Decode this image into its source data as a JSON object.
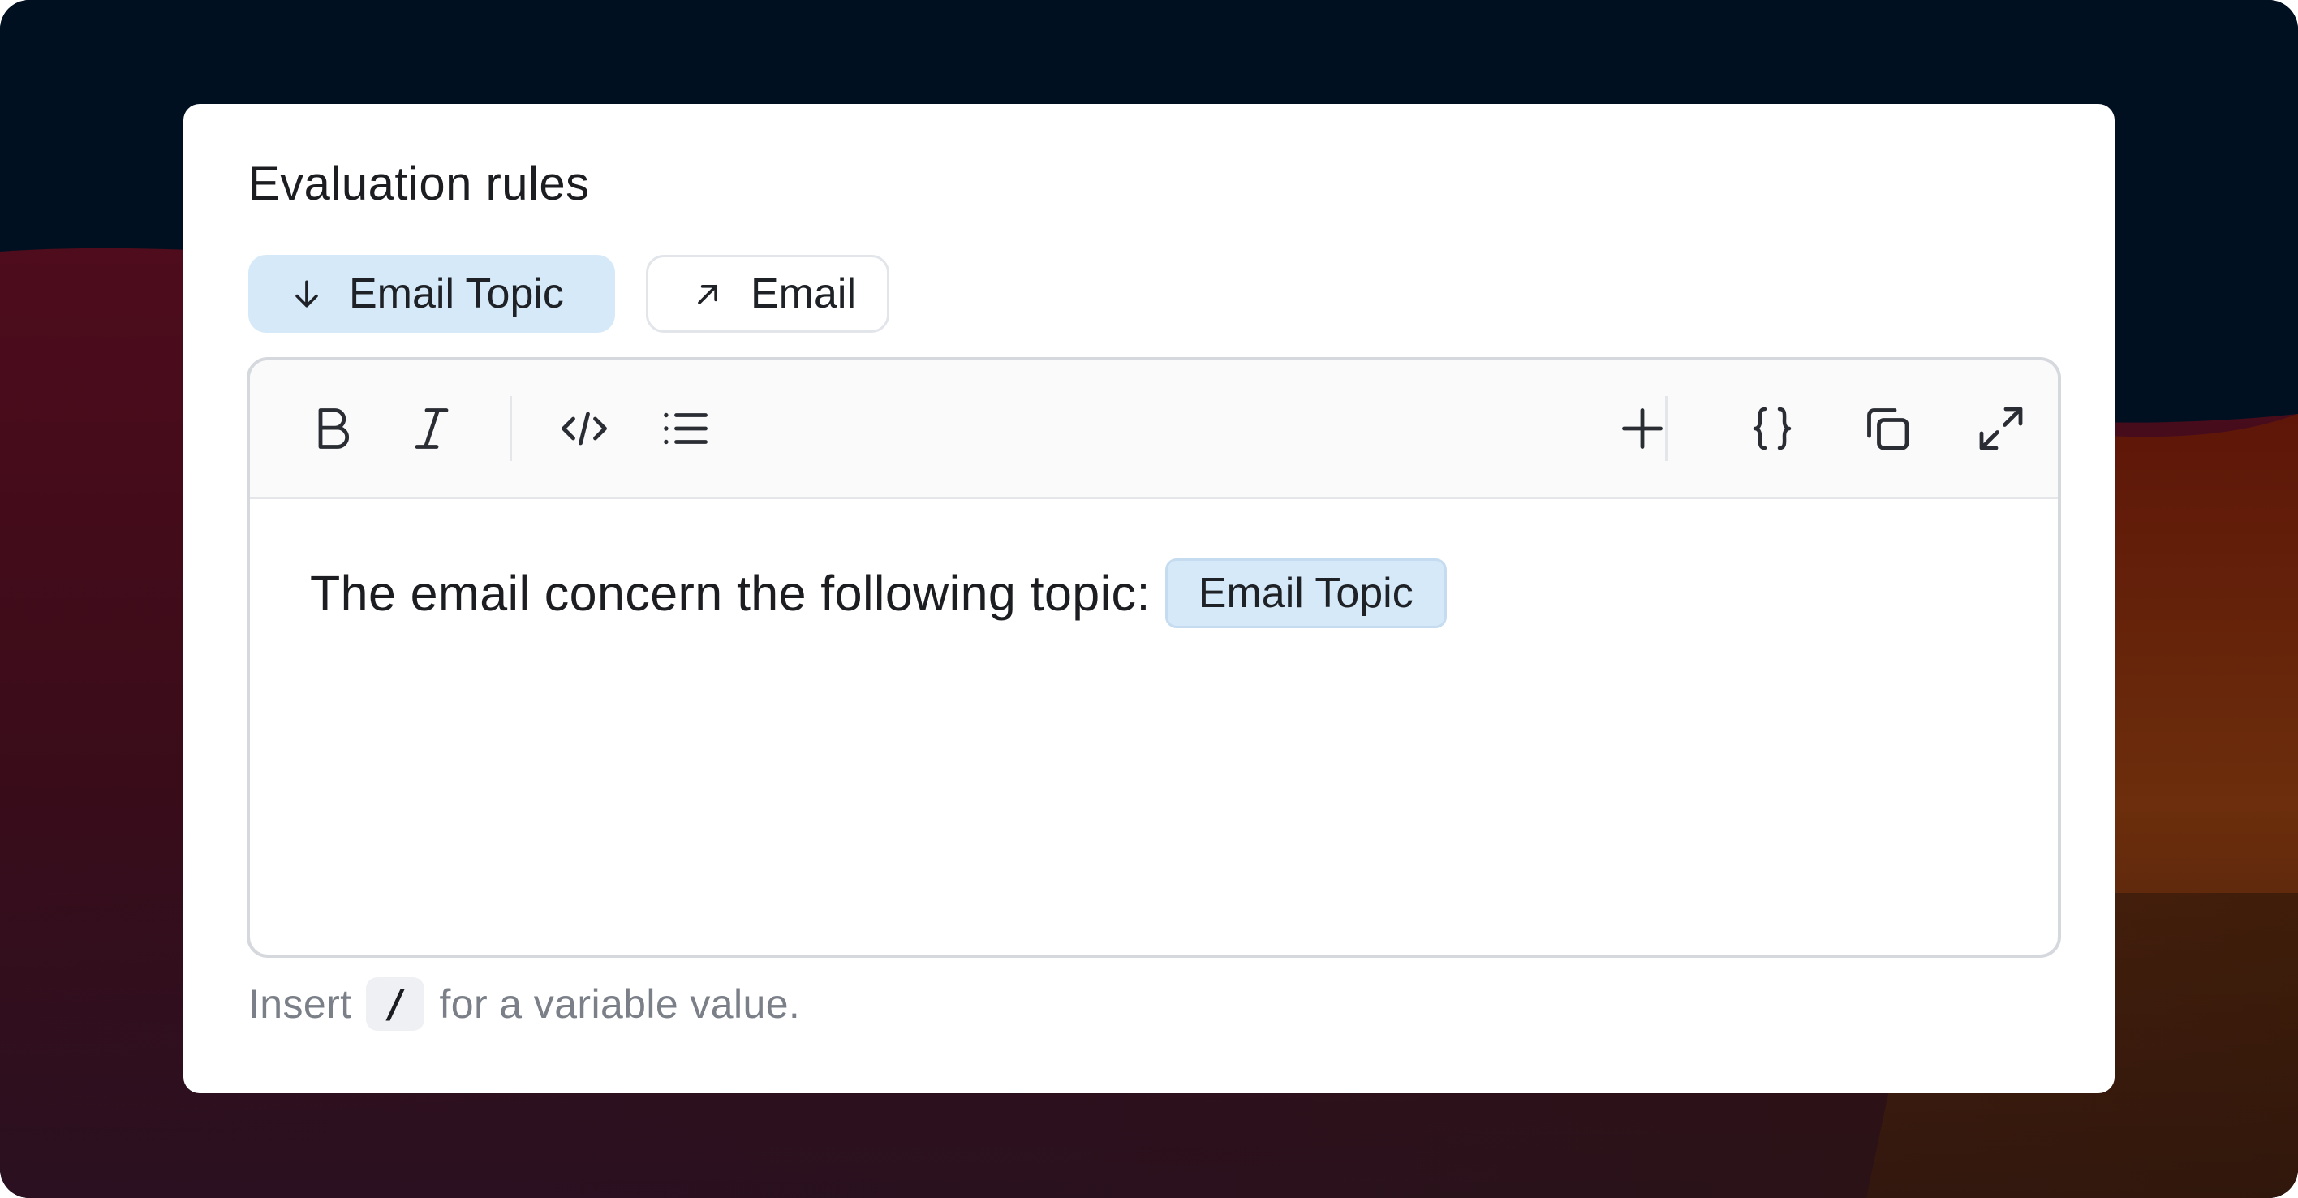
{
  "title": "Evaluation rules",
  "chips": {
    "input": {
      "label": "Email Topic",
      "icon": "arrow-down-icon"
    },
    "output": {
      "label": "Email",
      "icon": "arrow-up-right-icon"
    }
  },
  "toolbar": {
    "left": [
      "bold-icon",
      "italic-icon",
      "code-icon",
      "list-icon"
    ],
    "right": [
      "plus-icon",
      "braces-icon",
      "copy-icon",
      "expand-icon"
    ]
  },
  "editor": {
    "text": "The email concern the following topic:",
    "variable": "Email Topic"
  },
  "hint": {
    "before": "Insert",
    "key": "/",
    "after": "for a variable value."
  },
  "colors": {
    "chip_background": "#d6e9f8",
    "text": "#1c1d21",
    "muted_text": "#7a7f88",
    "card": "#ffffff"
  }
}
